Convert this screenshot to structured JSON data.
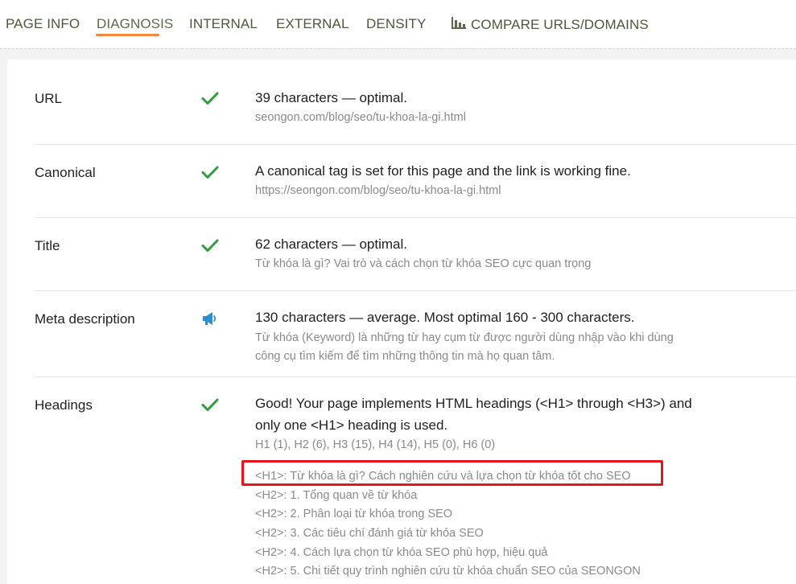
{
  "tabs": [
    {
      "label": "PAGE INFO"
    },
    {
      "label": "DIAGNOSIS"
    },
    {
      "label": "INTERNAL"
    },
    {
      "label": "EXTERNAL"
    },
    {
      "label": "DENSITY"
    },
    {
      "label": "COMPARE URLS/DOMAINS",
      "icon": "bar-chart-icon"
    }
  ],
  "active_tab": "DIAGNOSIS",
  "colors": {
    "accent": "#f08a3c",
    "ok": "#2e9e3e",
    "warn": "#2b8fd6",
    "highlight": "#e8141c"
  },
  "rows": {
    "url": {
      "label": "URL",
      "status_icon": "check-icon",
      "main": "39 characters — optimal.",
      "sub": "seongon.com/blog/seo/tu-khoa-la-gi.html"
    },
    "canonical": {
      "label": "Canonical",
      "status_icon": "check-icon",
      "main": "A canonical tag is set for this page and the link is working fine.",
      "sub": "https://seongon.com/blog/seo/tu-khoa-la-gi.html"
    },
    "title": {
      "label": "Title",
      "status_icon": "check-icon",
      "main": "62 characters — optimal.",
      "sub": "Từ khóa là gì? Vai trò và cách chọn từ khóa SEO cực quan trọng"
    },
    "meta": {
      "label": "Meta description",
      "status_icon": "megaphone-icon",
      "main": "130 characters — average. Most optimal 160 - 300 characters.",
      "sub_line1": "Từ khóa (Keyword) là những từ hay cụm từ được người dùng nhập vào khi dùng",
      "sub_line2": "công cụ tìm kiếm để tìm những thông tin mà họ quan tâm."
    },
    "headings": {
      "label": "Headings",
      "status_icon": "check-icon",
      "main_line1": "Good! Your page implements HTML headings (<H1> through <H3>) and",
      "main_line2": "only one <H1> heading is used.",
      "counts": "H1 (1), H2 (6), H3 (15), H4 (14), H5 (0), H6 (0)",
      "items": [
        "<H1>: Từ khóa là gì? Cách nghiên cứu và lựa chọn từ khóa tốt cho SEO",
        "<H2>: 1. Tổng quan về từ khóa",
        "<H2>: 2. Phân loại từ khóa trong SEO",
        "<H2>: 3. Các tiêu chí đánh giá từ khóa SEO",
        "<H2>: 4. Cách lựa chọn từ khóa SEO phù hợp, hiệu quả",
        "<H2>: 5. Chi tiết quy trình nghiên cứu từ khóa chuẩn SEO của SEONGON"
      ]
    }
  }
}
